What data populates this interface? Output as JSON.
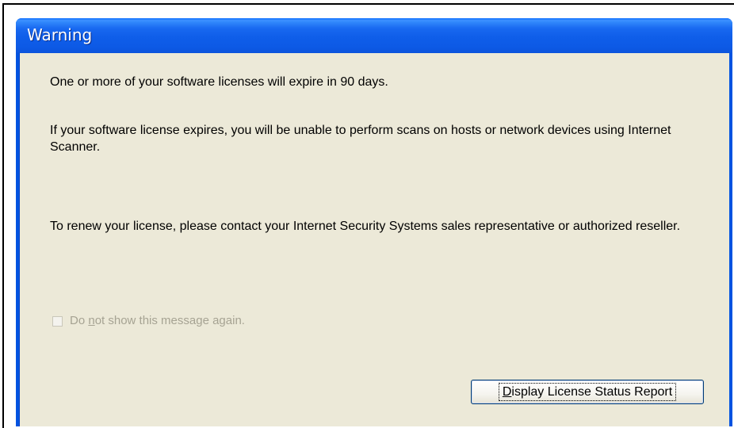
{
  "window": {
    "title": "Warning"
  },
  "messages": {
    "expire_notice": "One or more of your software licenses will expire in 90 days.",
    "consequence": "If your software license expires, you will be unable to perform scans on hosts or network devices using Internet Scanner.",
    "renew_instructions": "To renew your license, please contact your Internet Security Systems sales representative or authorized reseller."
  },
  "checkbox": {
    "label_prefix": "Do ",
    "label_mnemonic": "n",
    "label_suffix": "ot show this message again.",
    "checked": false,
    "enabled": false
  },
  "button": {
    "label_mnemonic": "D",
    "label_rest": "isplay License Status Report"
  },
  "colors": {
    "titlebar": "#0053e1",
    "client_background": "#ece9d8",
    "disabled_text": "#a6a393"
  }
}
